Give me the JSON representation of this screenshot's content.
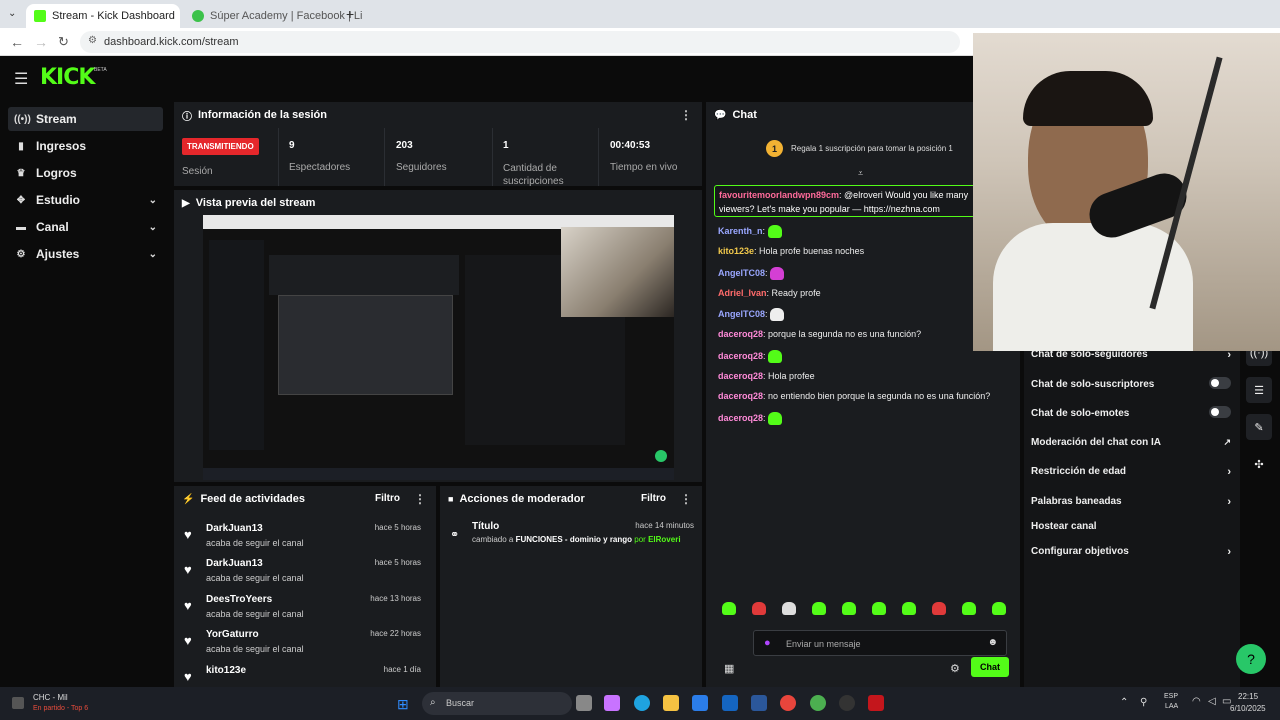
{
  "browser": {
    "tabs": [
      {
        "title": "Stream - Kick Dashboard",
        "active": true
      },
      {
        "title": "Súper Academy | Facebook | Li",
        "active": false
      }
    ],
    "url": "dashboard.kick.com/stream"
  },
  "brand": {
    "logo": "KICK",
    "beta": "BETA",
    "accent": "#53fc18"
  },
  "sidebar": {
    "items": [
      {
        "label": "Stream",
        "icon": "broadcast-icon",
        "active": true
      },
      {
        "label": "Ingresos",
        "icon": "revenue-icon"
      },
      {
        "label": "Logros",
        "icon": "trophy-icon"
      },
      {
        "label": "Estudio",
        "icon": "studio-icon",
        "expandable": true
      },
      {
        "label": "Canal",
        "icon": "channel-icon",
        "expandable": true
      },
      {
        "label": "Ajustes",
        "icon": "gear-icon",
        "expandable": true
      }
    ]
  },
  "session": {
    "title": "Información de la sesión",
    "badge": "TRANSMITIENDO",
    "badge_label": "Sesión",
    "stats": [
      {
        "value": "9",
        "label": "Espectadores"
      },
      {
        "value": "203",
        "label": "Seguidores"
      },
      {
        "value": "1",
        "label": "Cantidad de suscripciones"
      },
      {
        "value": "00:40:53",
        "label": "Tiempo en vivo"
      }
    ]
  },
  "preview": {
    "title": "Vista previa del stream"
  },
  "feed": {
    "title": "Feed de actividades",
    "filter": "Filtro",
    "items": [
      {
        "name": "DarkJuan13",
        "action": "acaba de seguir el canal",
        "time": "hace 5 horas"
      },
      {
        "name": "DarkJuan13",
        "action": "acaba de seguir el canal",
        "time": "hace 5 horas"
      },
      {
        "name": "DeesTroYeers",
        "action": "acaba de seguir el canal",
        "time": "hace 13 horas"
      },
      {
        "name": "YorGaturro",
        "action": "acaba de seguir el canal",
        "time": "hace 22 horas"
      },
      {
        "name": "kito123e",
        "action": "",
        "time": "hace 1 día"
      }
    ]
  },
  "modactions": {
    "title": "Acciones de moderador",
    "filter": "Filtro",
    "item": {
      "title": "Título",
      "time": "hace 14 minutos",
      "changed": "cambiado a",
      "value": "FUNCIONES - dominio y rango",
      "by": "por",
      "mod": "ElRoveri"
    }
  },
  "chat": {
    "title": "Chat",
    "gift_badge": "1",
    "gift_text": "Regala 1 suscripción para tomar la posición 1",
    "pinned_user": "favouritemoorlandwpn89cm",
    "pinned_text": "@elroveri Would you like many",
    "pinned_text2": "viewers? Let's make you popular — https://nezhna.com",
    "messages": [
      {
        "user": "Karenth_n",
        "text": "",
        "emote": true,
        "color": "#9aa7ff"
      },
      {
        "user": "kito123e",
        "text": "Hola profe buenas noches",
        "emote": false,
        "color": "#f2c94c"
      },
      {
        "user": "AngelTC08",
        "text": "",
        "emote": true,
        "color": "#9aa7ff"
      },
      {
        "user": "Adriel_Ivan",
        "text": "Ready profe",
        "emote": false,
        "color": "#ff6b6b"
      },
      {
        "user": "AngelTC08",
        "text": "",
        "emote": true,
        "color": "#9aa7ff"
      },
      {
        "user": "daceroq28",
        "text": "porque la segunda no es una función?",
        "emote": false,
        "color": "#ff8ad8"
      },
      {
        "user": "daceroq28",
        "text": "",
        "emote": true,
        "color": "#ff8ad8"
      },
      {
        "user": "daceroq28",
        "text": "Hola profee",
        "emote": false,
        "color": "#ff8ad8"
      },
      {
        "user": "daceroq28",
        "text": "no entiendo bien porque la segunda no es una función?",
        "emote": false,
        "color": "#ff8ad8"
      },
      {
        "user": "daceroq28",
        "text": "",
        "emote": true,
        "color": "#ff8ad8"
      }
    ],
    "input_placeholder": "Enviar un mensaje",
    "send_label": "Chat"
  },
  "chat_settings": {
    "items": [
      {
        "label": "Chat de solo-seguidores",
        "control": "arrow"
      },
      {
        "label": "Chat de solo-suscriptores",
        "control": "toggle"
      },
      {
        "label": "Chat de solo-emotes",
        "control": "toggle"
      },
      {
        "label": "Moderación del chat con IA",
        "control": "external"
      },
      {
        "label": "Restricción de edad",
        "control": "arrow"
      },
      {
        "label": "Palabras baneadas",
        "control": "arrow"
      },
      {
        "label": "Hostear canal",
        "control": "none"
      },
      {
        "label": "Configurar objetivos",
        "control": "arrow"
      }
    ]
  },
  "taskbar": {
    "weather_a": "CHC - Mil",
    "weather_b": "En partido - Top 6",
    "search": "Buscar",
    "lang": "ESP",
    "lang2": "LAA",
    "time": "22:15",
    "date": "6/10/2025"
  }
}
